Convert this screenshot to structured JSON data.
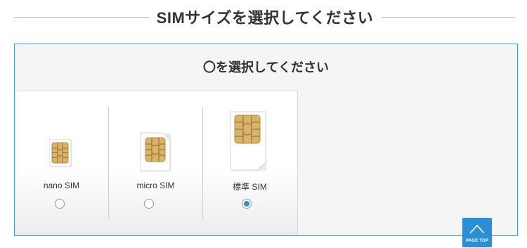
{
  "header": {
    "title": "SIMサイズを選択してください"
  },
  "selector": {
    "prompt": "〇を選択してください",
    "options": [
      {
        "label": "nano SIM",
        "selected": false,
        "icon": "nano-sim-card-icon"
      },
      {
        "label": "micro SIM",
        "selected": false,
        "icon": "micro-sim-card-icon"
      },
      {
        "label": "標準 SIM",
        "selected": true,
        "icon": "standard-sim-card-icon"
      }
    ]
  },
  "page_top": {
    "label": "PAGE TOP"
  },
  "colors": {
    "accent": "#2b8fd6",
    "panel_border": "#3aa0d8",
    "panel_bg": "#f5f5f5",
    "chip_gold": "#d9b36a"
  }
}
